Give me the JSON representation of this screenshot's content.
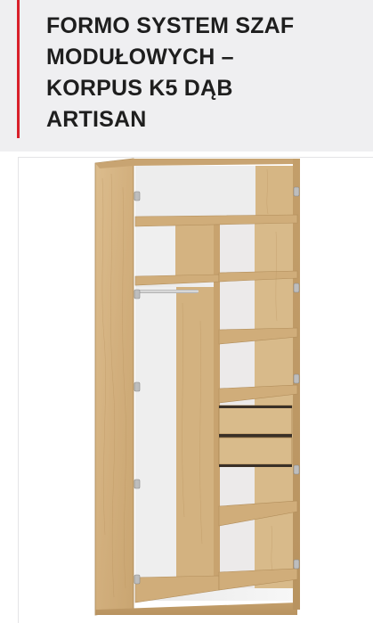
{
  "product": {
    "title": "FORMO SYSTEM SZAF\nMODUŁOWYCH –\n KORPUS K5 DĄB\nARTISAN"
  },
  "colors": {
    "accent": "#d8202a",
    "header_bg": "#efeff1",
    "wood": "#d7b685",
    "interior": "#f2f2f2"
  },
  "image": {
    "subject": "wardrobe-cabinet-illustration"
  }
}
